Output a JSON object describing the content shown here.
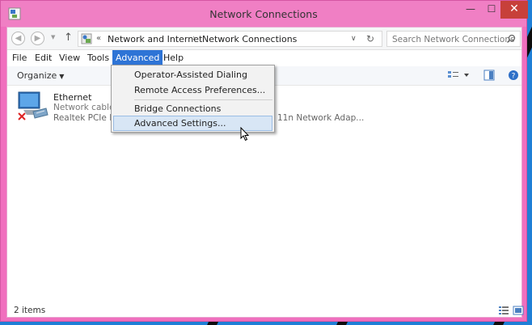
{
  "window": {
    "title": "Network Connections"
  },
  "titlebar_buttons": {
    "minimize": "—",
    "maximize": "☐",
    "close": "✕"
  },
  "address": {
    "prefix": "«",
    "crumbs": [
      "Network and Internet",
      "Network Connections"
    ],
    "separator": "›"
  },
  "search": {
    "placeholder": "Search Network Connections"
  },
  "menubar": {
    "items": [
      "File",
      "Edit",
      "View",
      "Tools",
      "Advanced",
      "Help"
    ],
    "active": "Advanced"
  },
  "command_bar": {
    "organize_label": "Organize"
  },
  "connections": [
    {
      "name": "Ethernet",
      "status": "Network cable u",
      "device": "Realtek PCIe FE F",
      "state": "disconnected"
    },
    {
      "device": "11n Network Adap..."
    }
  ],
  "advanced_menu": {
    "items": [
      "Operator-Assisted Dialing",
      "Remote Access Preferences...",
      "Bridge Connections",
      "Advanced Settings..."
    ],
    "highlighted": "Advanced Settings..."
  },
  "status_bar": {
    "item_count": "2 items"
  },
  "colors": {
    "window_frame": "#f06fbe",
    "menu_active": "#2e74d6",
    "close_button": "#c7403a",
    "desktop": "#1f7fd6"
  }
}
